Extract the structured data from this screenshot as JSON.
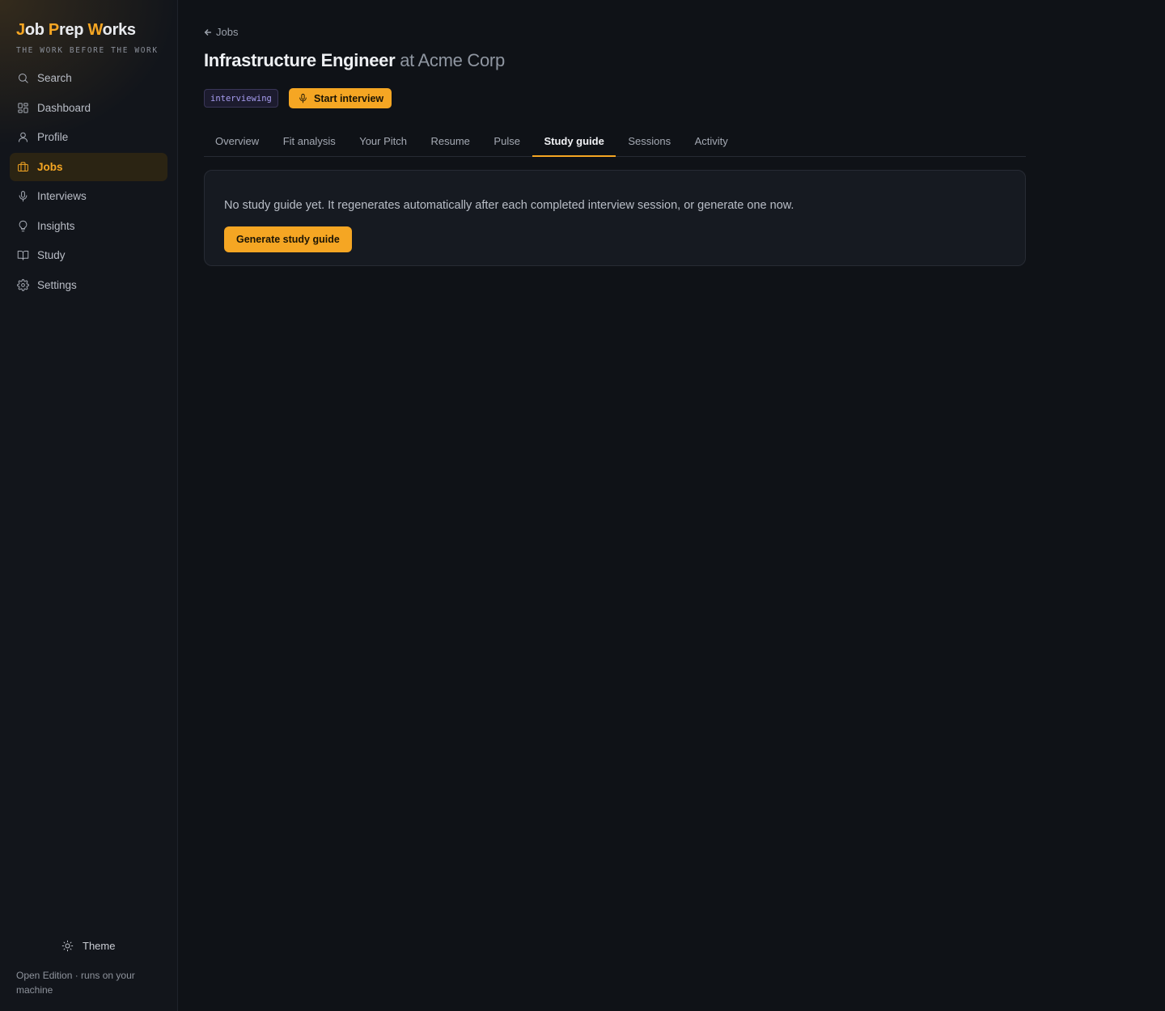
{
  "brand": {
    "part1": "J",
    "part2": "ob ",
    "part3": "P",
    "part4": "rep ",
    "part5": "W",
    "part6": "orks",
    "tagline": "THE WORK BEFORE THE WORK"
  },
  "sidebar": {
    "items": [
      {
        "label": "Search",
        "icon": "search-icon"
      },
      {
        "label": "Dashboard",
        "icon": "dashboard-icon"
      },
      {
        "label": "Profile",
        "icon": "user-icon"
      },
      {
        "label": "Jobs",
        "icon": "briefcase-icon",
        "active": true
      },
      {
        "label": "Interviews",
        "icon": "microphone-icon"
      },
      {
        "label": "Insights",
        "icon": "lightbulb-icon"
      },
      {
        "label": "Study",
        "icon": "book-icon"
      },
      {
        "label": "Settings",
        "icon": "gear-icon"
      }
    ],
    "theme_label": "Theme",
    "edition": "Open Edition · runs on your machine"
  },
  "header": {
    "back_label": "Jobs",
    "title": "Infrastructure Engineer",
    "company": "at Acme Corp",
    "status": "interviewing",
    "start_label": "Start interview"
  },
  "tabs": [
    {
      "label": "Overview"
    },
    {
      "label": "Fit analysis"
    },
    {
      "label": "Your Pitch"
    },
    {
      "label": "Resume"
    },
    {
      "label": "Pulse"
    },
    {
      "label": "Study guide",
      "active": true
    },
    {
      "label": "Sessions"
    },
    {
      "label": "Activity"
    }
  ],
  "study_guide": {
    "empty_message": "No study guide yet. It regenerates automatically after each completed interview session, or generate one now.",
    "generate_label": "Generate study guide"
  },
  "colors": {
    "accent": "#f5a623",
    "background": "#0f1217",
    "sidebar": "#12151b",
    "badge_text": "#a79df0"
  }
}
